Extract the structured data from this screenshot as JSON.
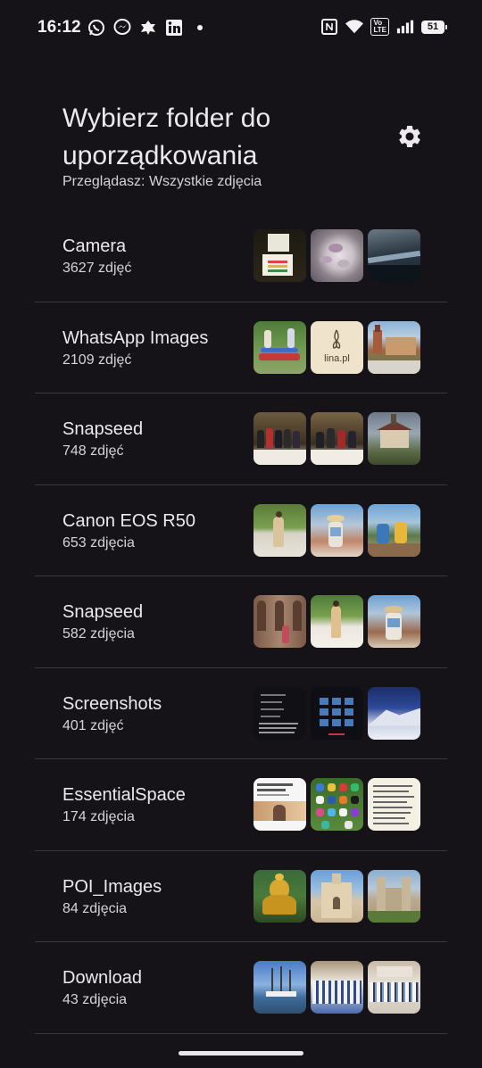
{
  "status_bar": {
    "time": "16:12",
    "left_icons": [
      "whatsapp-icon",
      "messenger-icon",
      "bug-icon",
      "linkedin-icon",
      "dot-icon"
    ],
    "right_icons": [
      "nfc-icon",
      "wifi-icon",
      "volte-icon",
      "signal-icon",
      "battery-icon"
    ],
    "volte_label": "Vo\nLTE",
    "battery_level": "51"
  },
  "header": {
    "title": "Wybierz folder do uporządkowania",
    "subtitle": "Przeglądasz: Wszystkie zdjęcia",
    "settings_icon": "gear-icon"
  },
  "folders": [
    {
      "name": "Camera",
      "count": "3627 zdjęć"
    },
    {
      "name": "WhatsApp Images",
      "count": "2109 zdjęć"
    },
    {
      "name": "Snapseed",
      "count": "748 zdjęć"
    },
    {
      "name": "Canon EOS R50",
      "count": "653 zdjęcia"
    },
    {
      "name": "Snapseed",
      "count": "582 zdjęcia"
    },
    {
      "name": "Screenshots",
      "count": "401 zdjęć"
    },
    {
      "name": "EssentialSpace",
      "count": "174 zdjęcia"
    },
    {
      "name": "POI_Images",
      "count": "84 zdjęcia"
    },
    {
      "name": "Download",
      "count": "43 zdjęcia"
    }
  ],
  "thumbnail_texts": {
    "lina_logo": "lina.pl"
  },
  "colors": {
    "background": "#151318",
    "text": "#ece8ee",
    "divider": "#3a373e"
  }
}
